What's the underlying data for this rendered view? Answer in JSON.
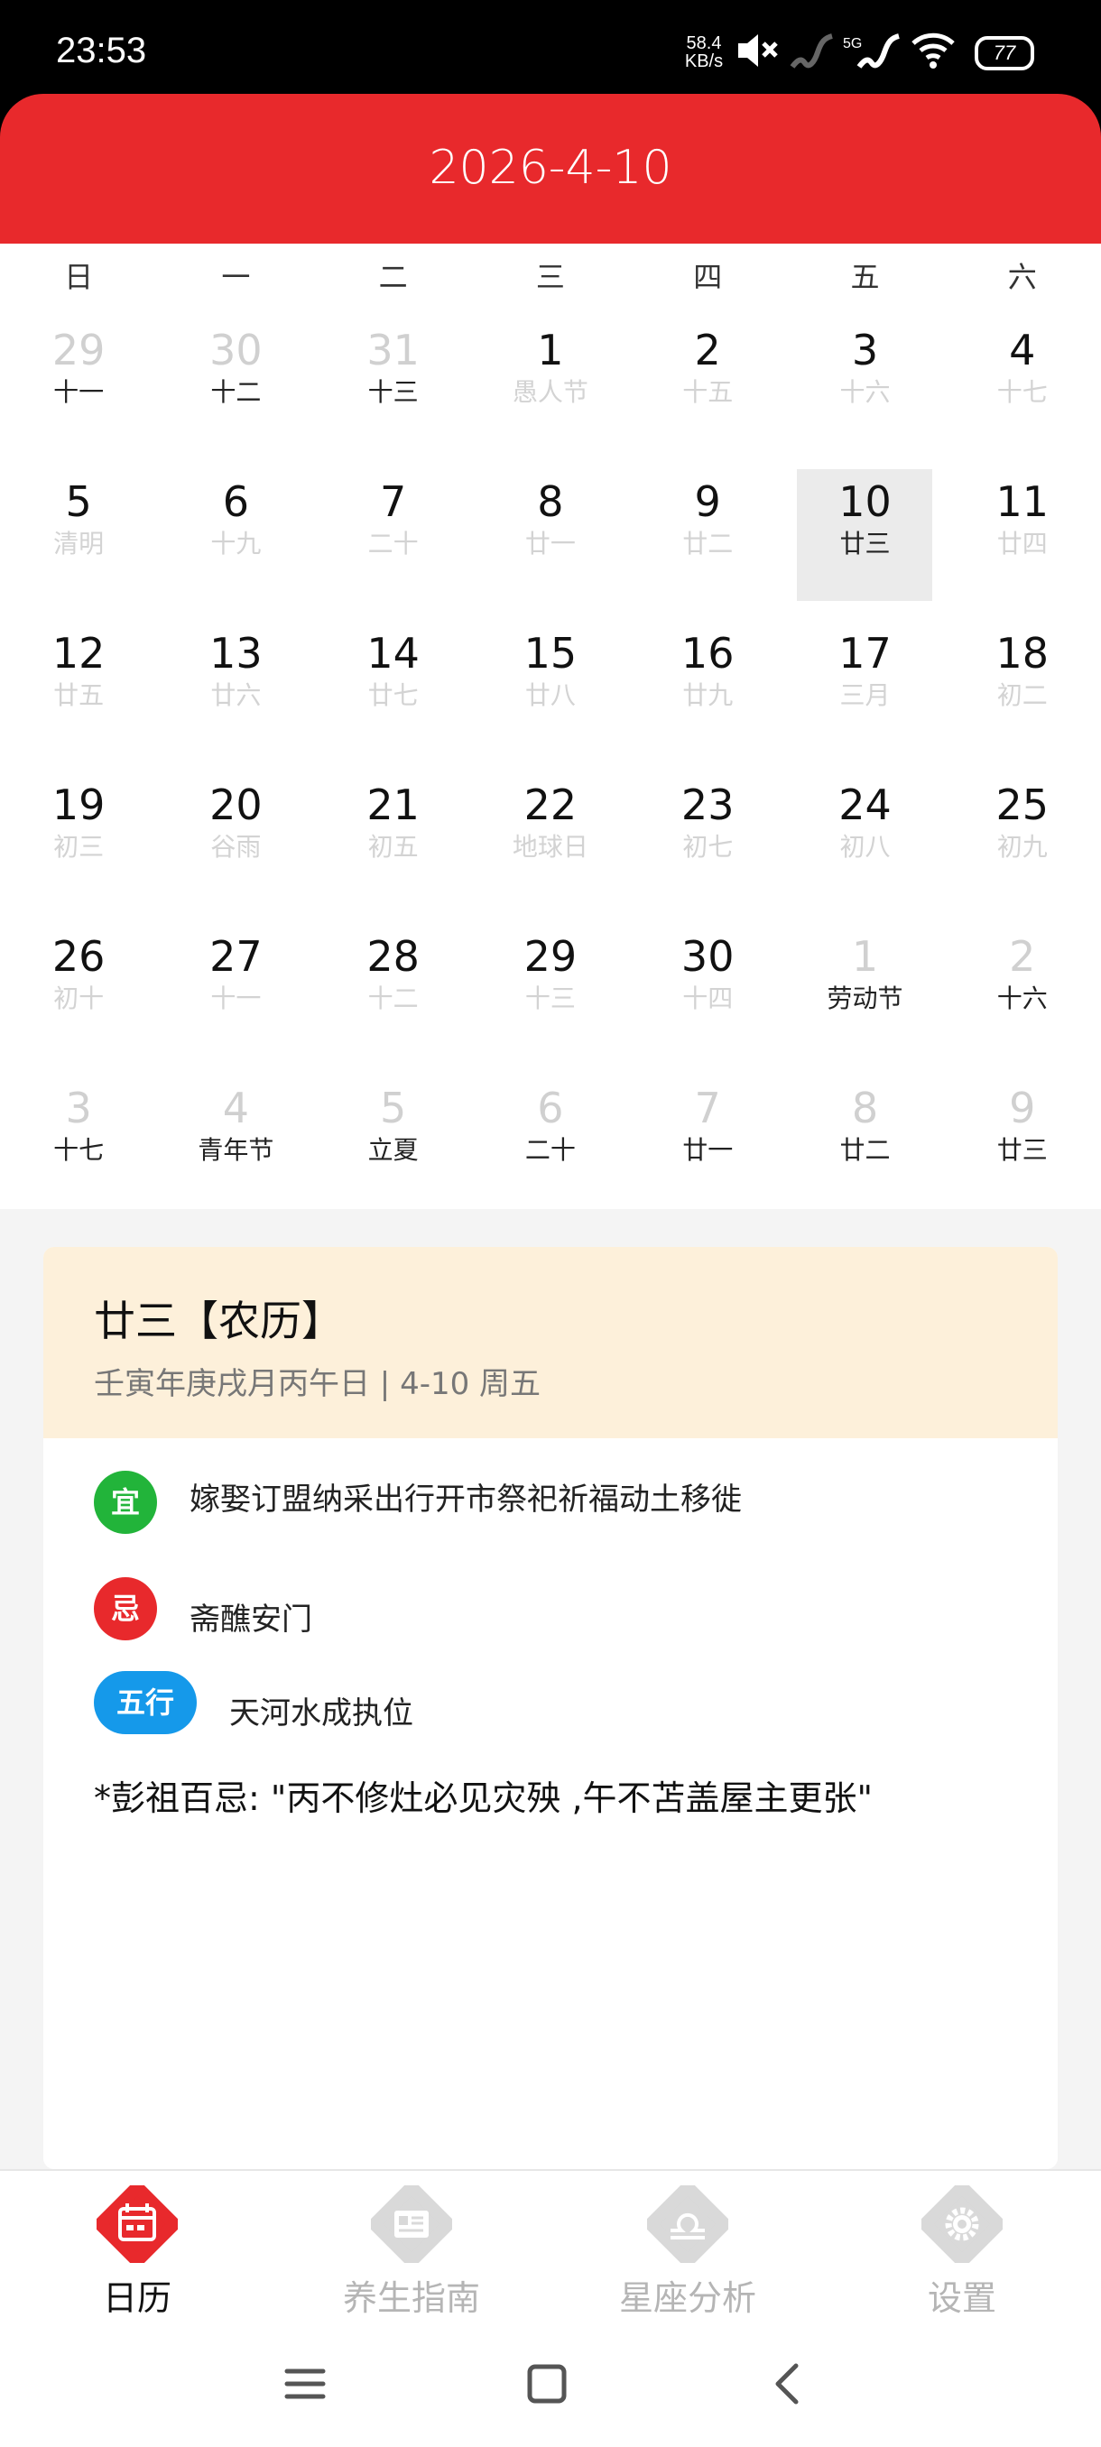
{
  "status": {
    "time": "23:53",
    "net_speed_value": "58.4",
    "net_speed_unit": "KB/s",
    "signal_label": "5G",
    "battery": "77"
  },
  "header": {
    "title": "2026-4-10"
  },
  "weekdays": [
    "日",
    "一",
    "二",
    "三",
    "四",
    "五",
    "六"
  ],
  "weeks": [
    [
      {
        "d": "29",
        "l": "十一",
        "out": true,
        "ld": true
      },
      {
        "d": "30",
        "l": "十二",
        "out": true,
        "ld": true
      },
      {
        "d": "31",
        "l": "十三",
        "out": true,
        "ld": true
      },
      {
        "d": "1",
        "l": "愚人节",
        "out": false,
        "ld": false
      },
      {
        "d": "2",
        "l": "十五",
        "out": false,
        "ld": false
      },
      {
        "d": "3",
        "l": "十六",
        "out": false,
        "ld": false
      },
      {
        "d": "4",
        "l": "十七",
        "out": false,
        "ld": false
      }
    ],
    [
      {
        "d": "5",
        "l": "清明",
        "out": false,
        "ld": false
      },
      {
        "d": "6",
        "l": "十九",
        "out": false,
        "ld": false
      },
      {
        "d": "7",
        "l": "二十",
        "out": false,
        "ld": false
      },
      {
        "d": "8",
        "l": "廿一",
        "out": false,
        "ld": false
      },
      {
        "d": "9",
        "l": "廿二",
        "out": false,
        "ld": false
      },
      {
        "d": "10",
        "l": "廿三",
        "out": false,
        "ld": true,
        "selected": true
      },
      {
        "d": "11",
        "l": "廿四",
        "out": false,
        "ld": false
      }
    ],
    [
      {
        "d": "12",
        "l": "廿五",
        "out": false,
        "ld": false
      },
      {
        "d": "13",
        "l": "廿六",
        "out": false,
        "ld": false
      },
      {
        "d": "14",
        "l": "廿七",
        "out": false,
        "ld": false
      },
      {
        "d": "15",
        "l": "廿八",
        "out": false,
        "ld": false
      },
      {
        "d": "16",
        "l": "廿九",
        "out": false,
        "ld": false
      },
      {
        "d": "17",
        "l": "三月",
        "out": false,
        "ld": false
      },
      {
        "d": "18",
        "l": "初二",
        "out": false,
        "ld": false
      }
    ],
    [
      {
        "d": "19",
        "l": "初三",
        "out": false,
        "ld": false
      },
      {
        "d": "20",
        "l": "谷雨",
        "out": false,
        "ld": false
      },
      {
        "d": "21",
        "l": "初五",
        "out": false,
        "ld": false
      },
      {
        "d": "22",
        "l": "地球日",
        "out": false,
        "ld": false
      },
      {
        "d": "23",
        "l": "初七",
        "out": false,
        "ld": false
      },
      {
        "d": "24",
        "l": "初八",
        "out": false,
        "ld": false
      },
      {
        "d": "25",
        "l": "初九",
        "out": false,
        "ld": false
      }
    ],
    [
      {
        "d": "26",
        "l": "初十",
        "out": false,
        "ld": false
      },
      {
        "d": "27",
        "l": "十一",
        "out": false,
        "ld": false
      },
      {
        "d": "28",
        "l": "十二",
        "out": false,
        "ld": false
      },
      {
        "d": "29",
        "l": "十三",
        "out": false,
        "ld": false
      },
      {
        "d": "30",
        "l": "十四",
        "out": false,
        "ld": false
      },
      {
        "d": "1",
        "l": "劳动节",
        "out": true,
        "ld": true
      },
      {
        "d": "2",
        "l": "十六",
        "out": true,
        "ld": true
      }
    ],
    [
      {
        "d": "3",
        "l": "十七",
        "out": true,
        "ld": true
      },
      {
        "d": "4",
        "l": "青年节",
        "out": true,
        "ld": true
      },
      {
        "d": "5",
        "l": "立夏",
        "out": true,
        "ld": true
      },
      {
        "d": "6",
        "l": "二十",
        "out": true,
        "ld": true
      },
      {
        "d": "7",
        "l": "廿一",
        "out": true,
        "ld": true
      },
      {
        "d": "8",
        "l": "廿二",
        "out": true,
        "ld": true
      },
      {
        "d": "9",
        "l": "廿三",
        "out": true,
        "ld": true
      }
    ]
  ],
  "detail": {
    "lunar_title": "廿三【农历】",
    "ganzhi": "壬寅年庚戌月丙午日 |  4-10   周五",
    "yi_badge": "宜",
    "yi_text": "嫁娶订盟纳采出行开市祭祀祈福动土移徙",
    "ji_badge": "忌",
    "ji_text": "斋醮安门",
    "wuxing_badge": "五行",
    "wuxing_text": "天河水成执位",
    "pengzu": "*彭祖百忌: \"丙不修灶必见灾殃 ,午不苫盖屋主更张\""
  },
  "nav": {
    "tabs": [
      {
        "label": "日历",
        "icon": "calendar-icon",
        "active": true
      },
      {
        "label": "养生指南",
        "icon": "guide-icon",
        "active": false
      },
      {
        "label": "星座分析",
        "icon": "zodiac-icon",
        "active": false
      },
      {
        "label": "设置",
        "icon": "settings-icon",
        "active": false
      }
    ]
  },
  "colors": {
    "accent": "#e8292c",
    "yi": "#22b43a",
    "ji": "#e8292c",
    "wuxing": "#1599ea",
    "card_head": "#fdf0da",
    "inactive_nav": "#d9d9d9"
  }
}
